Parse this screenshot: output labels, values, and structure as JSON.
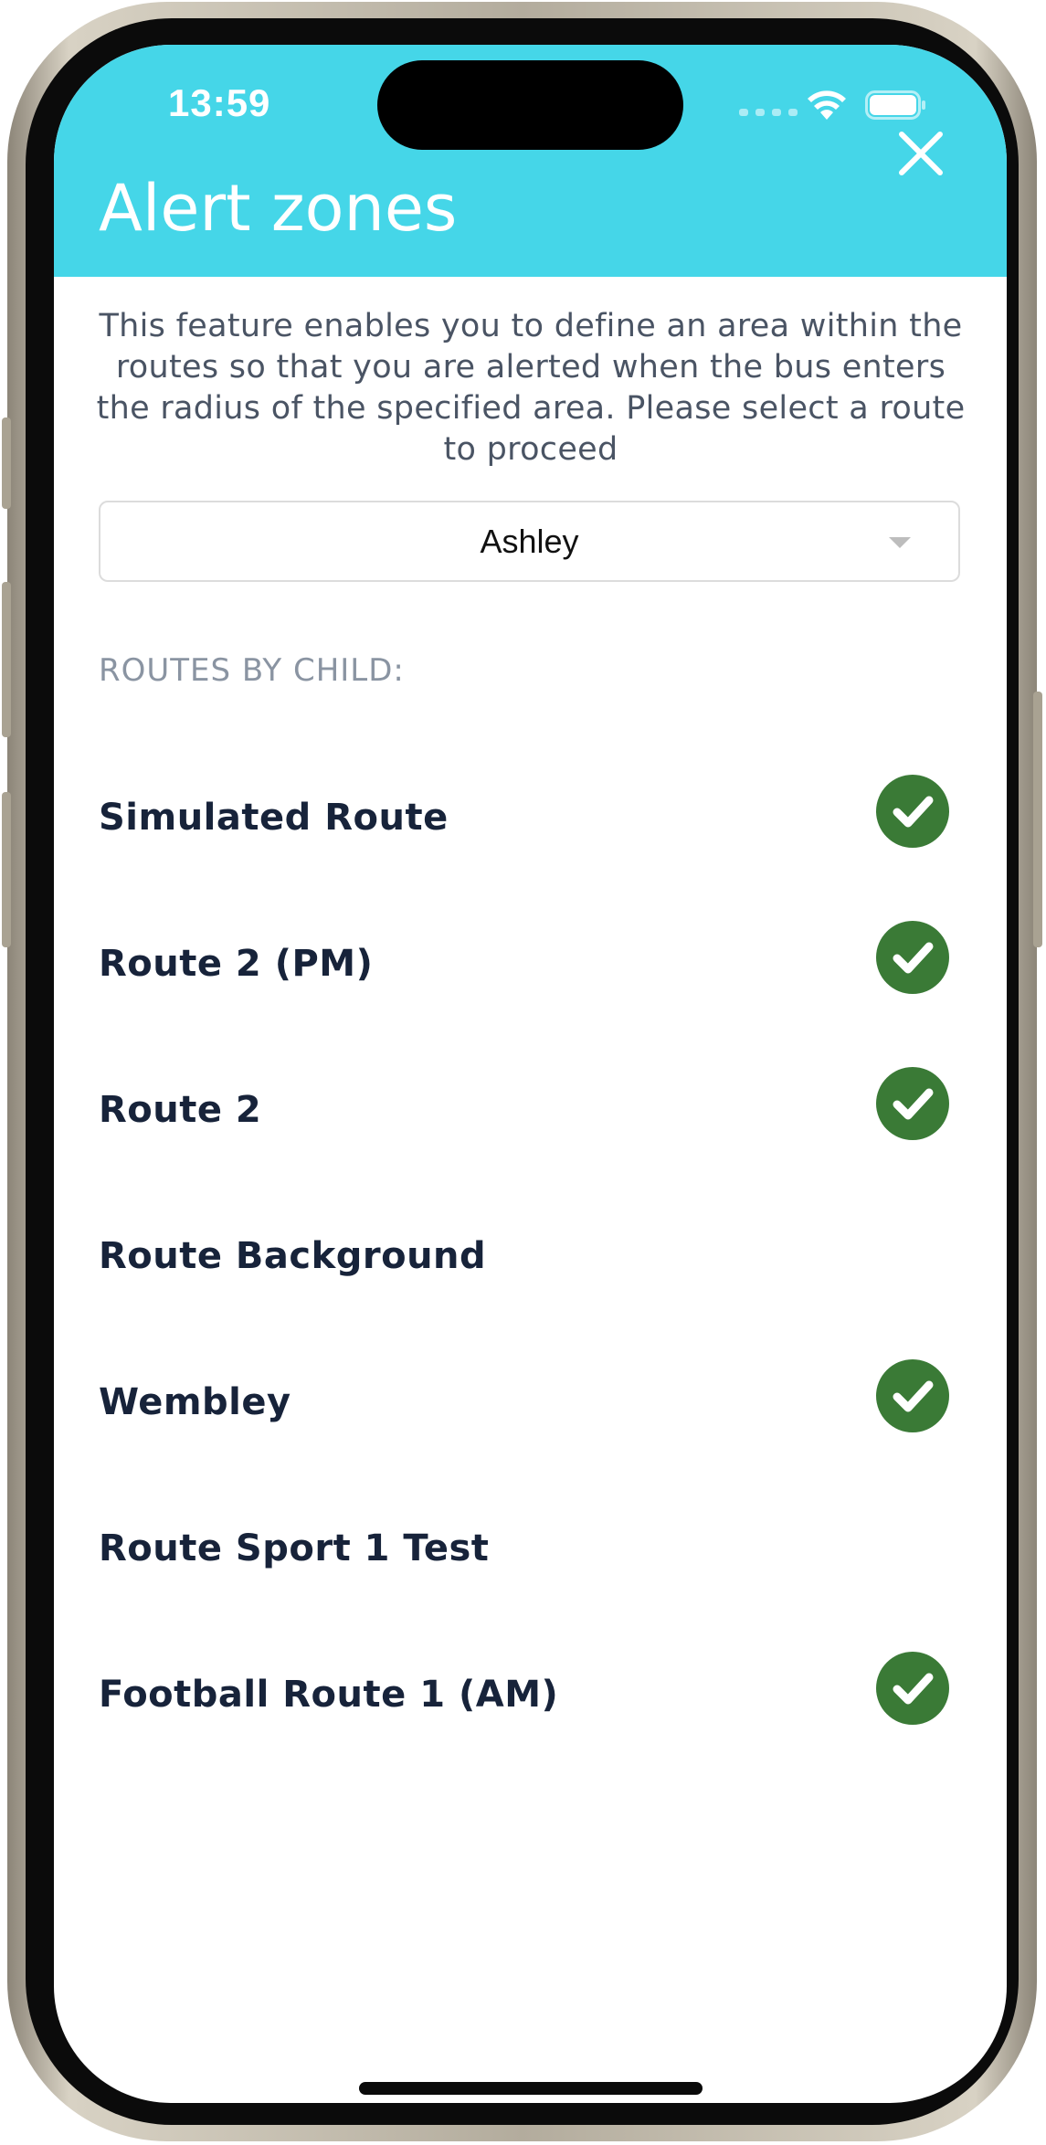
{
  "status_bar": {
    "time": "13:59"
  },
  "header": {
    "title": "Alert zones",
    "background_color": "#45d6e8",
    "close_icon": "close-icon"
  },
  "description": "This feature enables you to define an area within the routes so that you are alerted when the bus enters the radius of the specified area. Please select a route to proceed",
  "child_select": {
    "value": "Ashley"
  },
  "routes_section": {
    "label": "ROUTES BY CHILD:",
    "items": [
      {
        "name": "Simulated Route",
        "enabled": true
      },
      {
        "name": "Route 2 (PM)",
        "enabled": true
      },
      {
        "name": "Route 2",
        "enabled": true
      },
      {
        "name": "Route Background",
        "enabled": false
      },
      {
        "name": "Wembley",
        "enabled": true
      },
      {
        "name": "Route Sport 1 Test",
        "enabled": false
      },
      {
        "name": "Football Route 1 (AM)",
        "enabled": true
      }
    ]
  },
  "colors": {
    "check": "#3a7a36",
    "route_text": "#17233a",
    "section_label": "#8a94a2"
  }
}
